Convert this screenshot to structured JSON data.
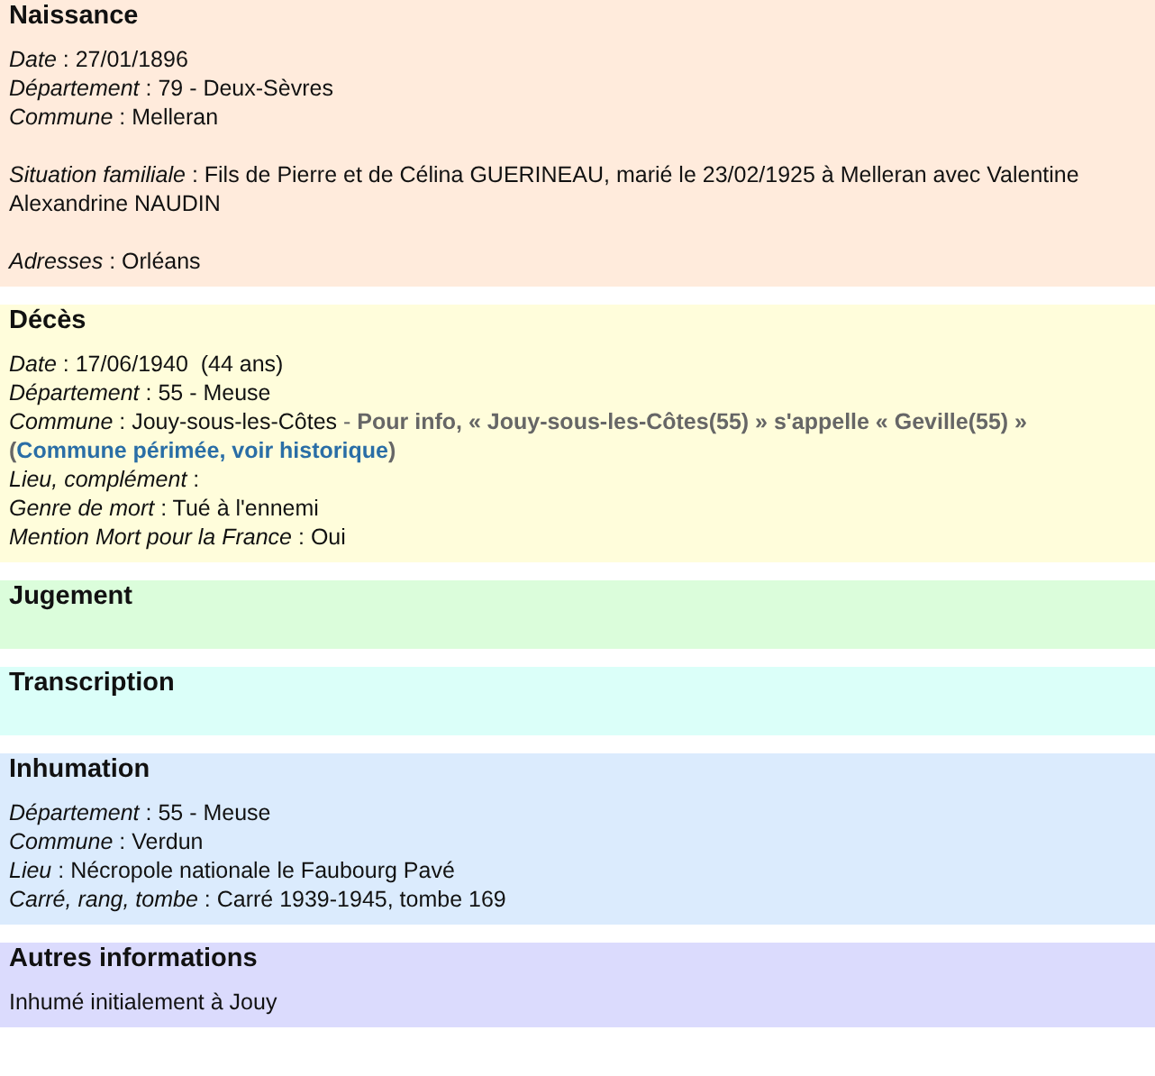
{
  "sections": [
    {
      "title": "Naissance",
      "color": "#ffebdc",
      "paragraphs": [
        [
          {
            "label": "Date",
            "value": ": 27/01/1896"
          },
          {
            "label": "Département",
            "value": ": 79 - Deux-Sèvres"
          },
          {
            "label": "Commune",
            "value": ": Melleran"
          }
        ],
        [
          {
            "label": "Situation familiale",
            "value": ": Fils de Pierre et de Célina GUERINEAU, marié le 23/02/1925 à Melleran avec Valentine Alexandrine NAUDIN"
          }
        ],
        [
          {
            "label": "Adresses",
            "value": ": Orléans"
          }
        ]
      ]
    },
    {
      "title": "Décès",
      "color": "#fffddb",
      "paragraphs": [
        [
          {
            "label": "Date",
            "value": ": 17/06/1940  (44 ans)"
          },
          {
            "label": "Département",
            "value": ": 55 - Meuse"
          },
          {
            "label": "Commune",
            "value": ": Jouy-sous-les-Côtes",
            "extras": [
              {
                "kind": "sep",
                "text": "-"
              },
              {
                "kind": "note",
                "text": "Pour info, « Jouy-sous-les-Côtes(55) » s'appelle « Geville(55) »"
              },
              {
                "kind": "paren_link",
                "open": "(",
                "text": "Commune périmée, voir historique",
                "close": ")"
              }
            ]
          },
          {
            "label": "Lieu, complément",
            "value": ":"
          },
          {
            "label": "Genre de mort",
            "value": ": Tué à l'ennemi"
          },
          {
            "label": "Mention Mort pour la France",
            "value": ": Oui"
          }
        ]
      ]
    },
    {
      "title": "Jugement",
      "color": "#dbfddb"
    },
    {
      "title": "Transcription",
      "color": "#dbfff9"
    },
    {
      "title": "Inhumation",
      "color": "#dbebfd",
      "paragraphs": [
        [
          {
            "label": "Département",
            "value": ": 55 - Meuse"
          },
          {
            "label": "Commune",
            "value": ": Verdun"
          },
          {
            "label": "Lieu",
            "value": ": Nécropole nationale le Faubourg Pavé"
          },
          {
            "label": "Carré, rang, tombe",
            "value": ": Carré 1939-1945, tombe 169"
          }
        ]
      ]
    },
    {
      "title": "Autres informations",
      "color": "#dbdbfd",
      "paragraphs": [
        [
          {
            "value": "Inhumé initialement à Jouy"
          }
        ]
      ]
    }
  ]
}
